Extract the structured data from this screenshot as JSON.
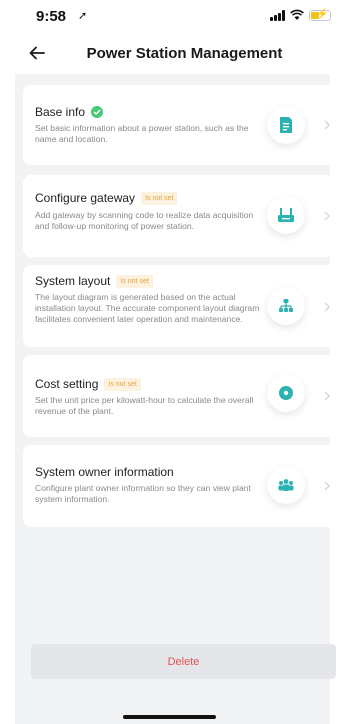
{
  "status_bar": {
    "time": "9:58",
    "location_glyph": "➚"
  },
  "header": {
    "title": "Power Station Management"
  },
  "cards": [
    {
      "title": "Base info",
      "badge": "",
      "description": "Set basic information about a power station, such as the name and location.",
      "icon": "document-icon"
    },
    {
      "title": "Configure gateway",
      "badge": "Is not set",
      "description": "Add gateway by scanning code to realize data acquisition and follow-up monitoring of power station.",
      "icon": "gateway-icon"
    },
    {
      "title": "System layout",
      "badge": "Is not set",
      "description": "The layout diagram is generated based on the actual installation layout. The accurate component layout diagram facilitates convenient later operation and maintenance.",
      "icon": "layout-icon"
    },
    {
      "title": "Cost setting",
      "badge": "Is not set",
      "description": "Set the unit price per kilowatt-hour to calculate the overall revenue of the plant.",
      "icon": "cost-icon"
    },
    {
      "title": "System owner information",
      "badge": "",
      "description": "Configure plant owner information so they can view plant system information.",
      "icon": "owner-icon"
    }
  ],
  "footer": {
    "delete_label": "Delete"
  },
  "colors": {
    "accent_teal": "#2bb3b1",
    "badge_orange": "#e8a23a",
    "success_green": "#48c774",
    "delete_red": "#e05555"
  }
}
